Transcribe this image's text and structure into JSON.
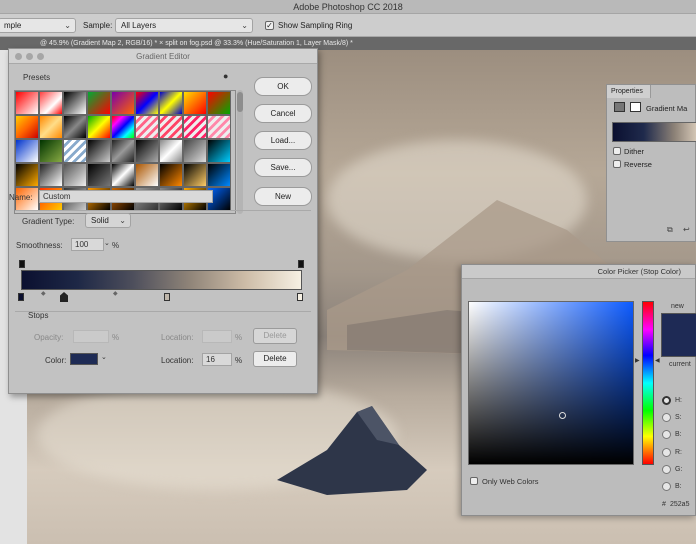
{
  "app": {
    "title": "Adobe Photoshop CC 2018"
  },
  "options_bar": {
    "mode_select": "mple",
    "sample_label": "Sample:",
    "sample_select": "All Layers",
    "show_sampling_ring": "Show Sampling Ring",
    "show_sampling_ring_checked": true
  },
  "document_tab": {
    "label": "@ 45.9% (Gradient Map 2, RGB/16) *   ×  split on fog.psd @ 33.3% (Hue/Saturation 1, Layer Mask/8) *"
  },
  "gradient_editor": {
    "title": "Gradient Editor",
    "presets_label": "Presets",
    "buttons": {
      "ok": "OK",
      "cancel": "Cancel",
      "load": "Load...",
      "save": "Save...",
      "new": "New"
    },
    "name_label": "Name:",
    "name_value": "Custom",
    "gradient_type_label": "Gradient Type:",
    "gradient_type_value": "Solid",
    "smoothness_label": "Smoothness:",
    "smoothness_value": "100",
    "smoothness_unit": "%",
    "stops_label": "Stops",
    "opacity_label": "Opacity:",
    "opacity_unit": "%",
    "location_label": "Location:",
    "location_unit": "%",
    "delete_label": "Delete",
    "color_label": "Color:",
    "color_location_value": "16",
    "stop_color": "#1e2b55",
    "gradient_colors": [
      "#0b1030",
      "#f6f0e3"
    ]
  },
  "properties": {
    "tab_label": "Properties",
    "layer_label": "Gradient Ma",
    "dither_label": "Dither",
    "reverse_label": "Reverse"
  },
  "color_picker": {
    "title": "Color Picker (Stop Color)",
    "new_label": "new",
    "current_label": "current",
    "only_web_colors": "Only Web Colors",
    "channels": [
      {
        "label": "H:",
        "selected": true
      },
      {
        "label": "S:",
        "selected": false
      },
      {
        "label": "B:",
        "selected": false
      },
      {
        "label": "R:",
        "selected": false
      },
      {
        "label": "G:",
        "selected": false
      },
      {
        "label": "B:",
        "selected": false
      }
    ],
    "hex_label": "#",
    "hex_value": "252a5",
    "selected_color": "#1e2a55"
  }
}
